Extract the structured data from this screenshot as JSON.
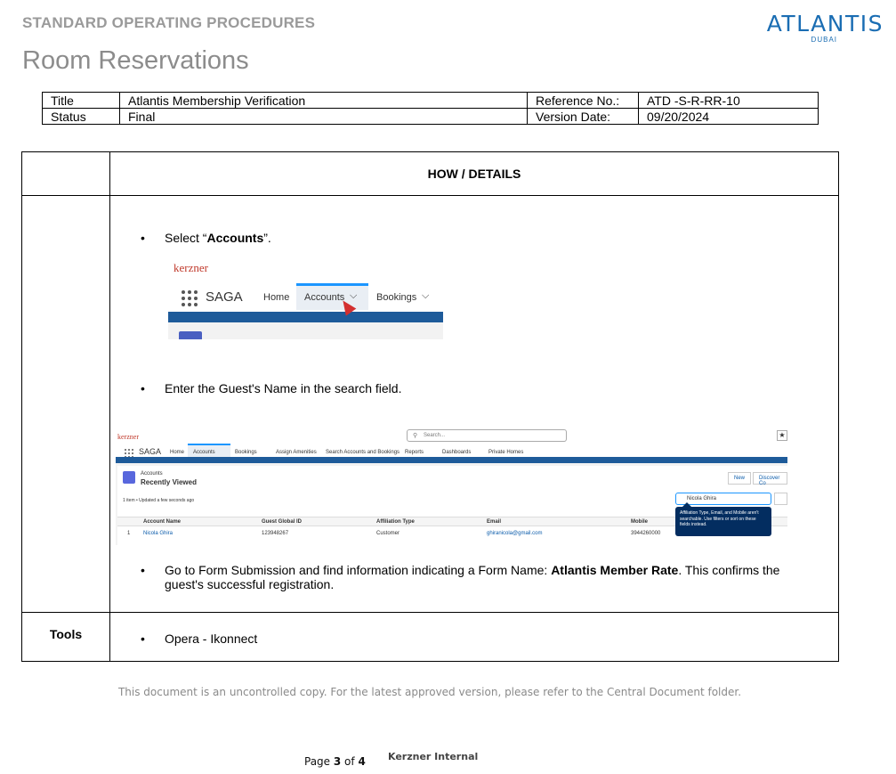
{
  "header": {
    "sop_label": "STANDARD OPERATING PROCEDURES",
    "section_title": "Room Reservations",
    "logo_name": "ATLANTIS",
    "logo_sub": "DUBAI"
  },
  "meta": {
    "title_label": "Title",
    "title_value": "Atlantis Membership Verification",
    "ref_label": "Reference No.:",
    "ref_value": "ATD -S-R-RR-10",
    "status_label": "Status",
    "status_value": "Final",
    "version_label": "Version Date:",
    "version_value": "09/20/2024"
  },
  "main": {
    "column_header": "HOW / DETAILS",
    "step1_prefix": "Select “",
    "step1_bold": "Accounts",
    "step1_suffix": "”.",
    "step2": "Enter the Guest's Name in the search field.",
    "step3_prefix": "Go to Form Submission and find information indicating a Form Name: ",
    "step3_bold": "Atlantis Member Rate",
    "step3_suffix": ". This confirms the guest's successful registration.",
    "tools_label": "Tools",
    "tools_value": "Opera - Ikonnect",
    "bullet": "•"
  },
  "shot1": {
    "brand": "kerzner",
    "app": "SAGA",
    "nav_home": "Home",
    "nav_accounts": "Accounts",
    "nav_bookings": "Bookings",
    "chevron": "⌵"
  },
  "shot2": {
    "brand": "kerzner",
    "search_placeholder": "Search...",
    "app": "SAGA",
    "nav": [
      "Home",
      "Accounts",
      "Bookings",
      "Assign Amenities",
      "Search Accounts and Bookings",
      "Reports",
      "Dashboards",
      "Private Homes"
    ],
    "object": "Accounts",
    "list_view": "Recently Viewed",
    "status_line": "1 item • Updated a few seconds ago",
    "btn_new": "New",
    "btn_discover": "Discover Co",
    "search_value": "Nicola Ghira",
    "columns": [
      "Account Name",
      "Guest Global ID",
      "Affiliation Type",
      "Email",
      "Mobile"
    ],
    "row": {
      "num": "1",
      "name": "Nicola Ghira",
      "guest_id": "123948267",
      "affiliation": "Customer",
      "email": "ghiranicola@gmail.com",
      "mobile": "3944260000"
    },
    "tooltip": "Affiliation Type, Email, and Mobile aren't searchable. Use filters or sort on these fields instead."
  },
  "footer": {
    "note": "This document is an uncontrolled copy. For the latest approved version, please refer to the Central Document folder.",
    "page_prefix": "Page ",
    "page_current": "3",
    "page_sep": " of ",
    "page_total": "4",
    "classification": "Kerzner Internal"
  },
  "colors": {
    "logo_blue": "#1a6db3",
    "salesforce_blue": "#1e5b9a",
    "link_blue": "#0b5cab",
    "cursor_red": "#d32f2f"
  }
}
